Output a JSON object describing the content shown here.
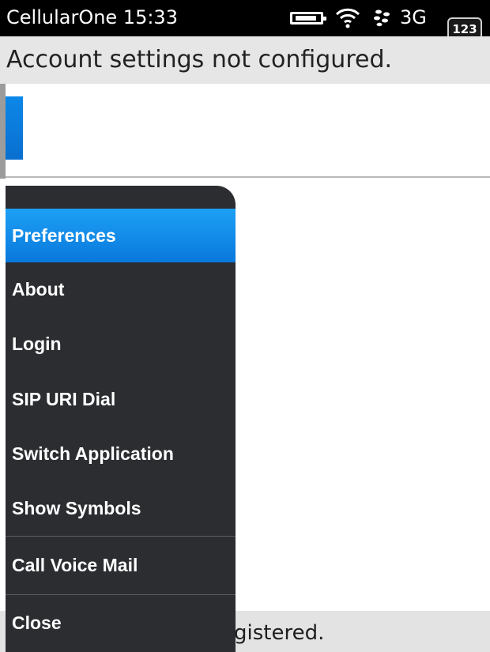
{
  "status_bar": {
    "carrier_time": "CellularOne 15:33",
    "network": "3G",
    "keyboard_badge": "123"
  },
  "banner": {
    "message": "Account settings not configured."
  },
  "menu": {
    "items": [
      {
        "label": "Preferences"
      },
      {
        "label": "About"
      },
      {
        "label": "Login"
      },
      {
        "label": "SIP URI Dial"
      },
      {
        "label": "Switch Application"
      },
      {
        "label": "Show Symbols"
      },
      {
        "label": "Call Voice Mail"
      },
      {
        "label": "Close"
      }
    ],
    "selected_index": 0
  },
  "footer": {
    "status_text": "gistered."
  },
  "colors": {
    "accent_blue": "#0a78dc",
    "menu_background": "#2b2d31"
  }
}
